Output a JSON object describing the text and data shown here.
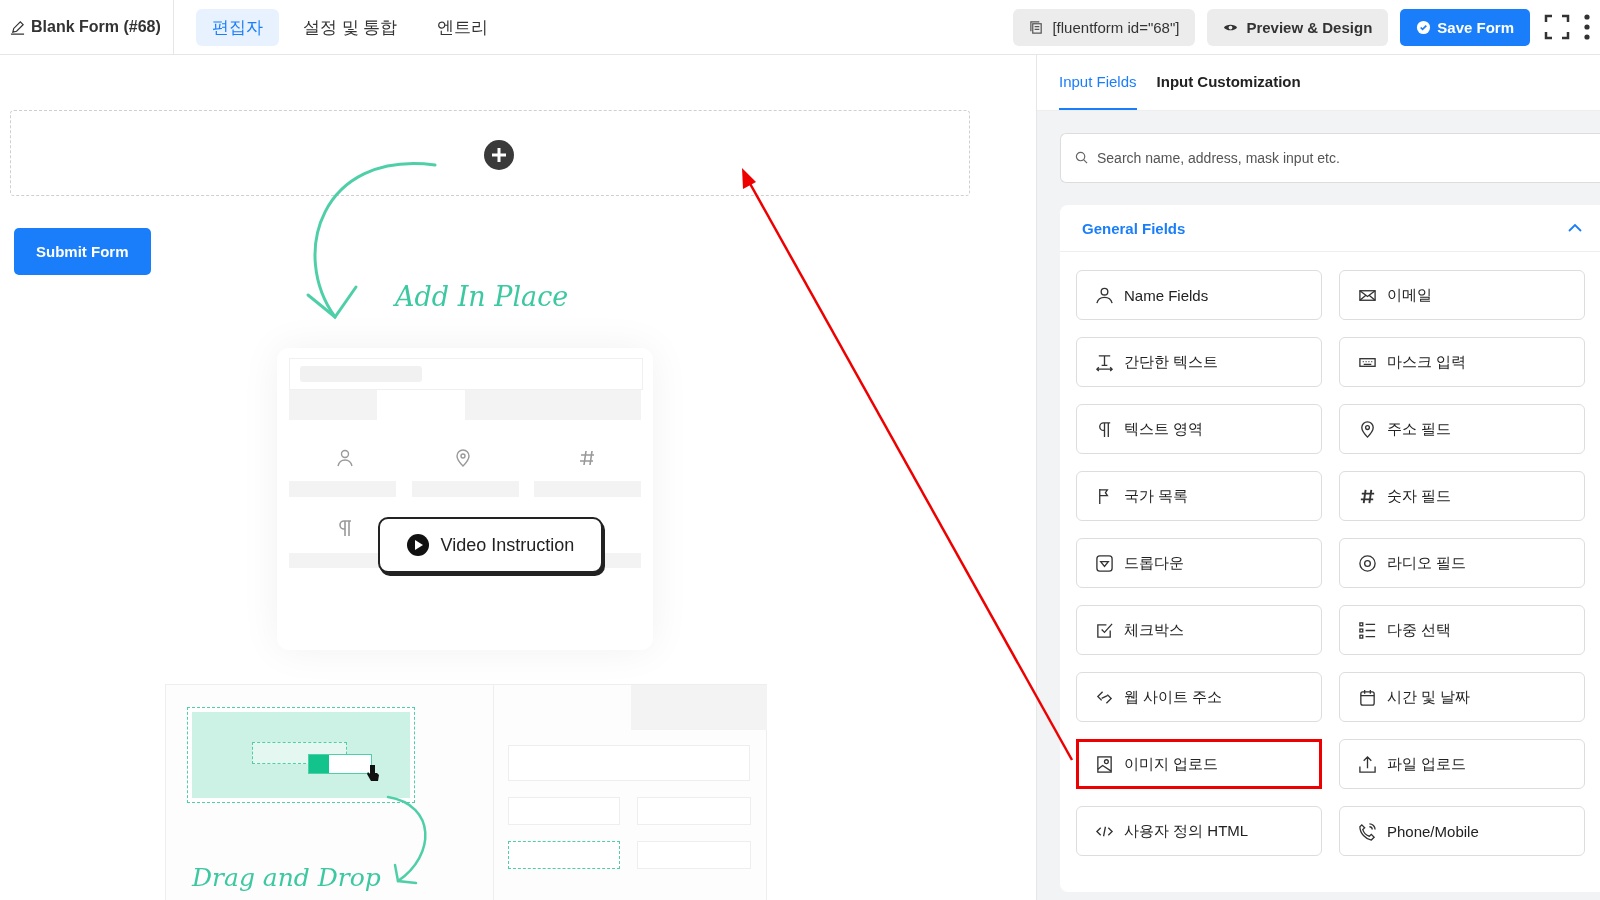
{
  "header": {
    "title": "Blank Form (#68)",
    "tabs": [
      {
        "label": "편집자",
        "selected": true
      },
      {
        "label": "설정 및 통합",
        "selected": false
      },
      {
        "label": "엔트리",
        "selected": false
      }
    ],
    "shortcode": "[fluentform id=\"68\"]",
    "preview_button": "Preview & Design",
    "save_button": "Save Form"
  },
  "canvas": {
    "submit_button": "Submit Form",
    "add_label": "Add In Place",
    "video_button": "Video Instruction",
    "drag_label": "Drag and Drop"
  },
  "panel": {
    "tabs": [
      {
        "label": "Input Fields",
        "selected": true
      },
      {
        "label": "Input Customization",
        "selected": false
      }
    ],
    "search": {
      "placeholder": "Search name, address, mask input etc."
    },
    "section": {
      "title": "General Fields",
      "expanded": true,
      "fields": [
        {
          "label": "Name Fields",
          "kind": "person",
          "highlighted": false
        },
        {
          "label": "이메일",
          "kind": "envelope",
          "highlighted": false
        },
        {
          "label": "간단한 텍스트",
          "kind": "text",
          "highlighted": false
        },
        {
          "label": "마스크 입력",
          "kind": "keyboard",
          "highlighted": false
        },
        {
          "label": "텍스트 영역",
          "kind": "paragraph",
          "highlighted": false
        },
        {
          "label": "주소 필드",
          "kind": "pin",
          "highlighted": false
        },
        {
          "label": "국가 목록",
          "kind": "flag",
          "highlighted": false
        },
        {
          "label": "숫자 필드",
          "kind": "hash",
          "highlighted": false
        },
        {
          "label": "드롭다운",
          "kind": "dropdown",
          "highlighted": false
        },
        {
          "label": "라디오 필드",
          "kind": "radio",
          "highlighted": false
        },
        {
          "label": "체크박스",
          "kind": "checkbox",
          "highlighted": false
        },
        {
          "label": "다중 선택",
          "kind": "list",
          "highlighted": false
        },
        {
          "label": "웹 사이트 주소",
          "kind": "link",
          "highlighted": false
        },
        {
          "label": "시간 및 날짜",
          "kind": "calendar",
          "highlighted": false
        },
        {
          "label": "이미지 업로드",
          "kind": "image",
          "highlighted": true
        },
        {
          "label": "파일 업로드",
          "kind": "upload",
          "highlighted": false
        },
        {
          "label": "사용자 정의 HTML",
          "kind": "code",
          "highlighted": false
        },
        {
          "label": "Phone/Mobile",
          "kind": "phone",
          "highlighted": false
        }
      ]
    }
  }
}
